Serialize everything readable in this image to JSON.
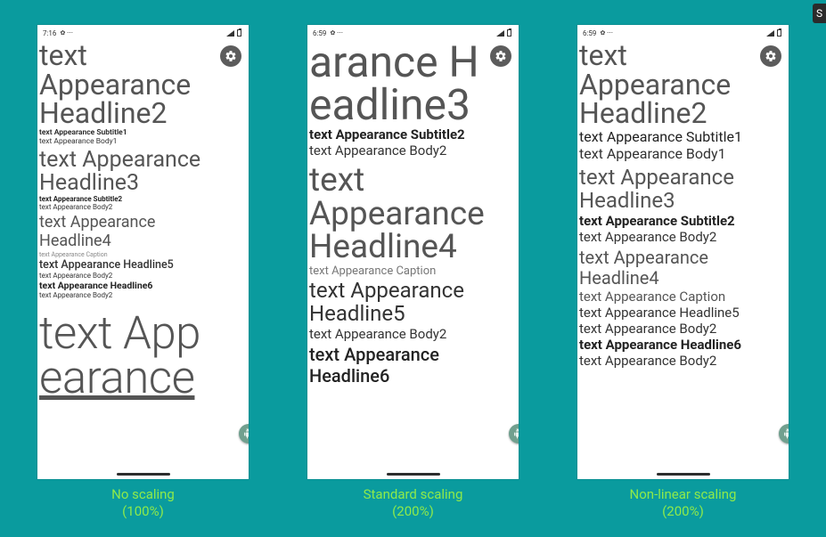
{
  "side_tab": "S",
  "statusbar": {
    "p1_time": "7:16",
    "p23_time": "6:59",
    "after": "✿ ⋯"
  },
  "strings": {
    "h2a": "text",
    "h2b": "Appearance",
    "h2c": "Headline2",
    "sub1": "text Appearance Subtitle1",
    "body1": "text Appearance Body1",
    "h3a": "text Appearance",
    "h3b": "Headline3",
    "sub2": "text Appearance Subtitle2",
    "body2": "text Appearance Body2",
    "h4a": "text Appearance",
    "h4b": "Headline4",
    "caption": "text Appearance Caption",
    "h5": "text Appearance Headline5",
    "h6": "text Appearance Headline6",
    "h1cut_a": "text App",
    "h1cut_b": "earance",
    "p2_h3_a": "arance H",
    "p2_h3_b": "eadline3",
    "p2_h5a": "text Appearance",
    "p2_h5b": "Headline5",
    "p2_h6a": "text Appearance",
    "p2_h6b": "Headline6",
    "p3_h4a": "text Appearance",
    "p3_h4b": "Headline4"
  },
  "captions": {
    "c1a": "No scaling",
    "c1b": "(100%)",
    "c2a": "Standard scaling",
    "c2b": "(200%)",
    "c3a": "Non-linear scaling",
    "c3b": "(200%)"
  }
}
